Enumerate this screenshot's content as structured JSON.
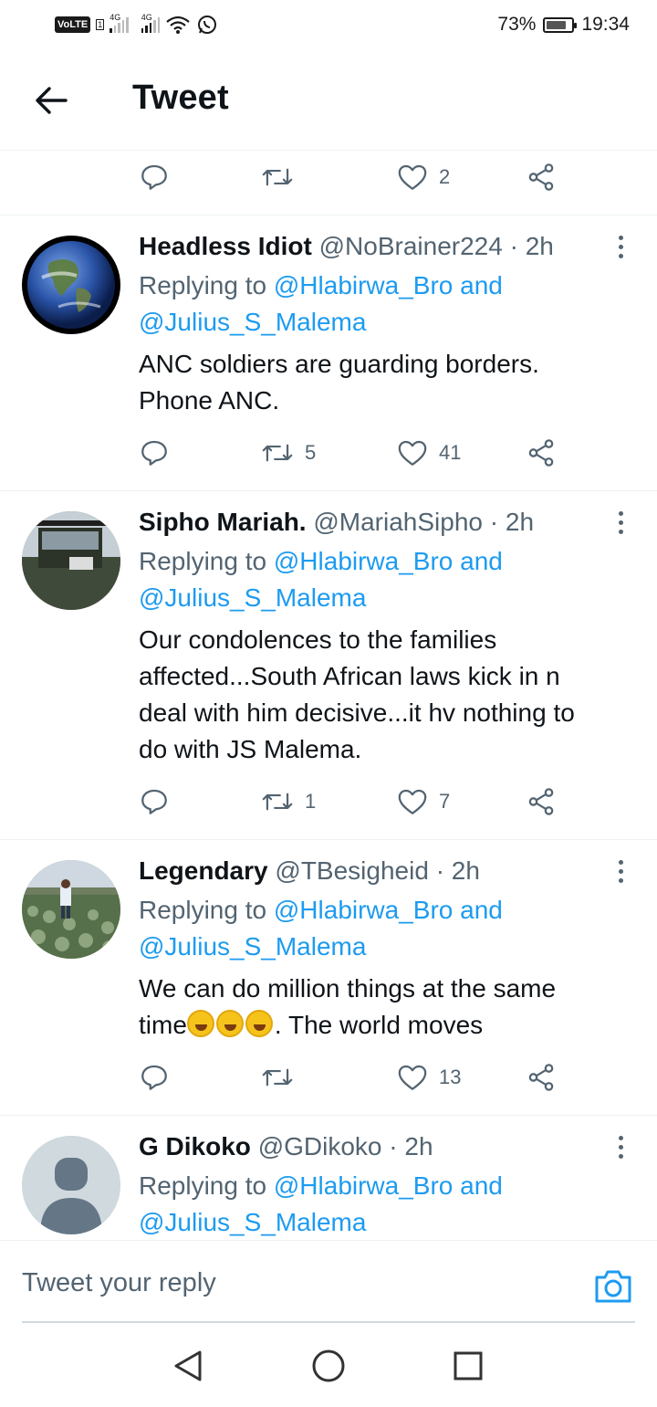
{
  "status_bar": {
    "volte": "VoLTE",
    "sim": "1",
    "network_1": "4G",
    "network_2": "4G",
    "battery": "73%",
    "time": "19:34"
  },
  "header": {
    "title": "Tweet"
  },
  "top_actions": {
    "retweets": "",
    "likes": "2"
  },
  "replies": [
    {
      "name": "Headless Idiot",
      "handle": "@NoBrainer224",
      "time": "· 2h",
      "replying_prefix": "Replying to",
      "replying_to_1": "@Hlabirwa_Bro",
      "replying_and": "and",
      "replying_to_2": "@Julius_S_Malema",
      "text_lines": [
        "ANC soldiers are guarding borders.",
        "Phone ANC."
      ],
      "retweets": "5",
      "likes": "41"
    },
    {
      "name": "Sipho Mariah.",
      "handle": "@MariahSipho",
      "time": "· 2h",
      "replying_prefix": "Replying to",
      "replying_to_1": "@Hlabirwa_Bro",
      "replying_and": "and",
      "replying_to_2": "@Julius_S_Malema",
      "text_lines": [
        "Our condolences to the families",
        "affected...South African laws kick in n",
        "deal with him decisive...it hv nothing to",
        "do with JS Malema."
      ],
      "retweets": "1",
      "likes": "7"
    },
    {
      "name": "Legendary",
      "handle": "@TBesigheid",
      "time": "· 2h",
      "replying_prefix": "Replying to",
      "replying_to_1": "@Hlabirwa_Bro",
      "replying_and": "and",
      "replying_to_2": "@Julius_S_Malema",
      "text_lines": [
        "We can do million things at the same",
        "time",
        ". The world moves"
      ],
      "retweets": "",
      "likes": "13"
    },
    {
      "name": "G Dikoko",
      "handle": "@GDikoko",
      "time": "· 2h",
      "replying_prefix": "Replying to",
      "replying_to_1": "@Hlabirwa_Bro",
      "replying_and": "and",
      "replying_to_2": "@Julius_S_Malema"
    }
  ],
  "composer": {
    "placeholder": "Tweet your reply"
  },
  "colors": {
    "link": "#1d9bf0",
    "secondary": "#536471",
    "divider": "#eff3f4"
  },
  "icons": [
    "back-arrow-icon",
    "reply-icon",
    "retweet-icon",
    "like-icon",
    "share-icon",
    "more-icon",
    "camera-icon",
    "nav-back-icon",
    "nav-home-icon",
    "nav-recents-icon"
  ]
}
